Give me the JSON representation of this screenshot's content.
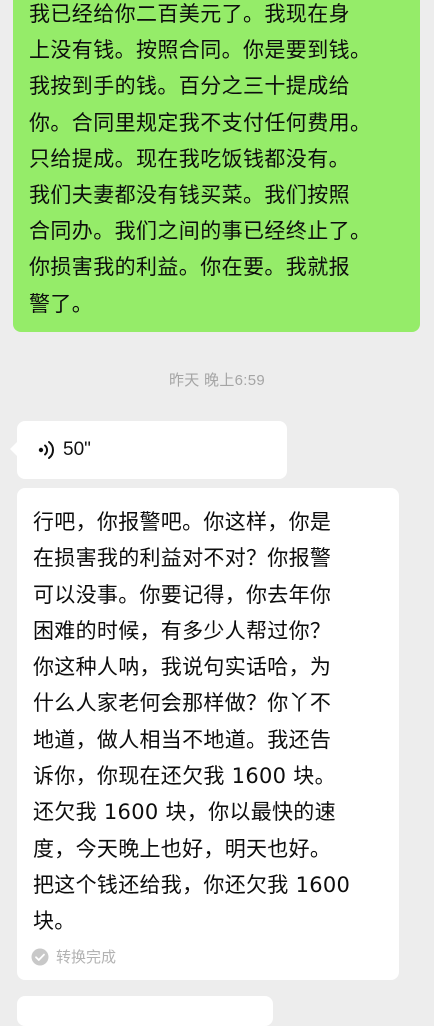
{
  "chat": {
    "sent_message": {
      "text": "我已经给你二百美元了。我现在身\n上没有钱。按照合同。你是要到钱。\n我按到手的钱。百分之三十提成给\n你。合同里规定我不支付任何费用。\n只给提成。现在我吃饭钱都没有。\n我们夫妻都没有钱买菜。我们按照\n合同办。我们之间的事已经终止了。\n你损害我的利益。你在要。我就报\n警了。",
      "bubble_color": "#95ec69"
    },
    "timestamp": "昨天 晚上6:59",
    "received_voice": {
      "icon": "voice-wave-icon",
      "duration": "50\""
    },
    "transcript": {
      "text": "行吧，你报警吧。你这样，你是\n在损害我的利益对不对？你报警\n可以没事。你要记得，你去年你\n困难的时候，有多少人帮过你？\n你这种人呐，我说句实话哈，为\n什么人家老何会那样做？你丫不\n地道，做人相当不地道。我还告\n诉你，你现在还欠我 1600 块。\n还欠我 1600 块，你以最快的速\n度，今天晚上也好，明天也好。\n把这个钱还给我，你还欠我 1600\n块。",
      "status_icon": "check-circle-icon",
      "status_label": "转换完成"
    }
  },
  "colors": {
    "background": "#ededed",
    "incoming_bubble": "#ffffff",
    "outgoing_bubble": "#95ec69",
    "muted_text": "#a5a5a5"
  }
}
